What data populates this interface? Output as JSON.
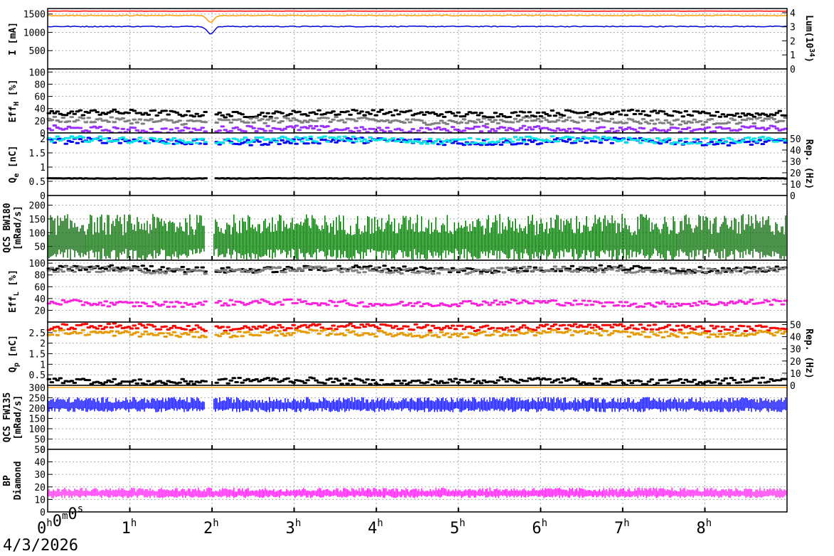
{
  "date": "4/3/2026",
  "time_axis": {
    "ticks": [
      {
        "h": 0,
        "label": "0",
        "sup": "h",
        "label2": "0",
        "sup2": "m",
        "label3": "0",
        "sup3": "s"
      },
      {
        "h": 1,
        "label": "1",
        "sup": "h"
      },
      {
        "h": 2,
        "label": "2",
        "sup": "h"
      },
      {
        "h": 3,
        "label": "3",
        "sup": "h"
      },
      {
        "h": 4,
        "label": "4",
        "sup": "h"
      },
      {
        "h": 5,
        "label": "5",
        "sup": "h"
      },
      {
        "h": 6,
        "label": "6",
        "sup": "h"
      },
      {
        "h": 7,
        "label": "7",
        "sup": "h"
      },
      {
        "h": 8,
        "label": "8",
        "sup": "h"
      }
    ],
    "range_hours": [
      0,
      9
    ]
  },
  "chart_data": [
    {
      "id": "current",
      "type": "line",
      "ylabel": "I [mA]",
      "ylim": [
        0,
        1650
      ],
      "yticks": [
        500,
        1000,
        1500
      ],
      "y2label": "Lum(10^34)",
      "y2label_parts": {
        "base": "Lum(10",
        "sup": "34",
        "end": ")"
      },
      "y2lim": [
        0,
        4.3
      ],
      "y2ticks": [
        0,
        1,
        2,
        3,
        4
      ],
      "series": [
        {
          "color": "#ff0000",
          "level": 1580,
          "dip": 0
        },
        {
          "color": "#ffa000",
          "level": 1460,
          "dip": 190
        },
        {
          "color": "#0000dd",
          "level": 1160,
          "dip": 200
        }
      ]
    },
    {
      "id": "eff_h",
      "type": "scatter",
      "ylabel": "Eff_H [%]",
      "ylabel_parts": {
        "base": "Eff",
        "sub": "H",
        "end": " [%]"
      },
      "ylim": [
        0,
        105
      ],
      "yticks": [
        0,
        20,
        40,
        60,
        80,
        100
      ],
      "series": [
        {
          "color": "#000000",
          "level": 32
        },
        {
          "color": "#808080",
          "level": 20
        },
        {
          "color": "#9b30ff",
          "level": 6
        }
      ]
    },
    {
      "id": "qe",
      "type": "scatter",
      "ylabel": "Q_e [nC]",
      "ylabel_parts": {
        "base": "Q",
        "sub": "e",
        "end": " [nC]"
      },
      "ylim": [
        0,
        2.2
      ],
      "yticks": [
        0,
        0.5,
        1,
        1.5,
        2
      ],
      "ytick_labels": [
        "0",
        "0.5",
        "1",
        "1.5",
        "2"
      ],
      "y2label": "Rep. (Hz)",
      "y2lim": [
        0,
        55
      ],
      "y2ticks": [
        0,
        10,
        20,
        30,
        40,
        50
      ],
      "series": [
        {
          "color": "#0000ff",
          "level": 1.9
        },
        {
          "color": "#00e5e5",
          "level": 1.95
        },
        {
          "color": "#000000",
          "level": 0.6
        }
      ]
    },
    {
      "id": "qcs_bw",
      "type": "line",
      "ylabel": "QCS BW180",
      "ylabel2": "[mRad/s]",
      "ylim": [
        0,
        235
      ],
      "yticks": [
        50,
        100,
        150,
        200
      ],
      "series": [
        {
          "color": "#006400",
          "level": 70
        }
      ]
    },
    {
      "id": "eff_l",
      "type": "scatter",
      "ylabel": "Eff_L [%]",
      "ylabel_parts": {
        "base": "Eff",
        "sub": "L",
        "end": " [%]"
      },
      "ylim": [
        0,
        105
      ],
      "yticks": [
        20,
        40,
        60,
        80,
        100
      ],
      "series": [
        {
          "color": "#000000",
          "level": 90
        },
        {
          "color": "#808080",
          "level": 88
        },
        {
          "color": "#ff22dd",
          "level": 32
        }
      ]
    },
    {
      "id": "qp",
      "type": "scatter",
      "ylabel": "Q_p [nC]",
      "ylabel_parts": {
        "base": "Q",
        "sub": "p",
        "end": " [nC]"
      },
      "ylim": [
        0,
        3
      ],
      "yticks": [
        0.5,
        1,
        1.5,
        2,
        2.5
      ],
      "ytick_labels": [
        "0.5",
        "1",
        "1.5",
        "2",
        "2.5"
      ],
      "y2label": "Rep. (Hz)",
      "y2lim": [
        0,
        52
      ],
      "y2ticks": [
        0,
        10,
        20,
        30,
        40,
        50
      ],
      "series": [
        {
          "color": "#ff0000",
          "level": 2.75
        },
        {
          "color": "#e69b00",
          "level": 2.45
        },
        {
          "color": "#000000",
          "level": 0.2
        }
      ]
    },
    {
      "id": "qcs_fw",
      "type": "line",
      "ylabel": "QCS FW135",
      "ylabel2": "[mRad/s]",
      "ylim": [
        0,
        310
      ],
      "yticks": [
        0,
        50,
        100,
        150,
        200,
        250,
        300
      ],
      "series": [
        {
          "color": "#0000ff",
          "level": 215
        },
        {
          "color": "#ffa000",
          "level": 300
        }
      ]
    },
    {
      "id": "bp_diamond",
      "type": "line",
      "ylabel": "BP",
      "ylabel2": "Diamond",
      "ylim": [
        0,
        50
      ],
      "yticks": [
        0,
        10,
        20,
        30,
        40,
        50
      ],
      "series": [
        {
          "color": "#ff22ee",
          "level": 15
        }
      ]
    }
  ]
}
